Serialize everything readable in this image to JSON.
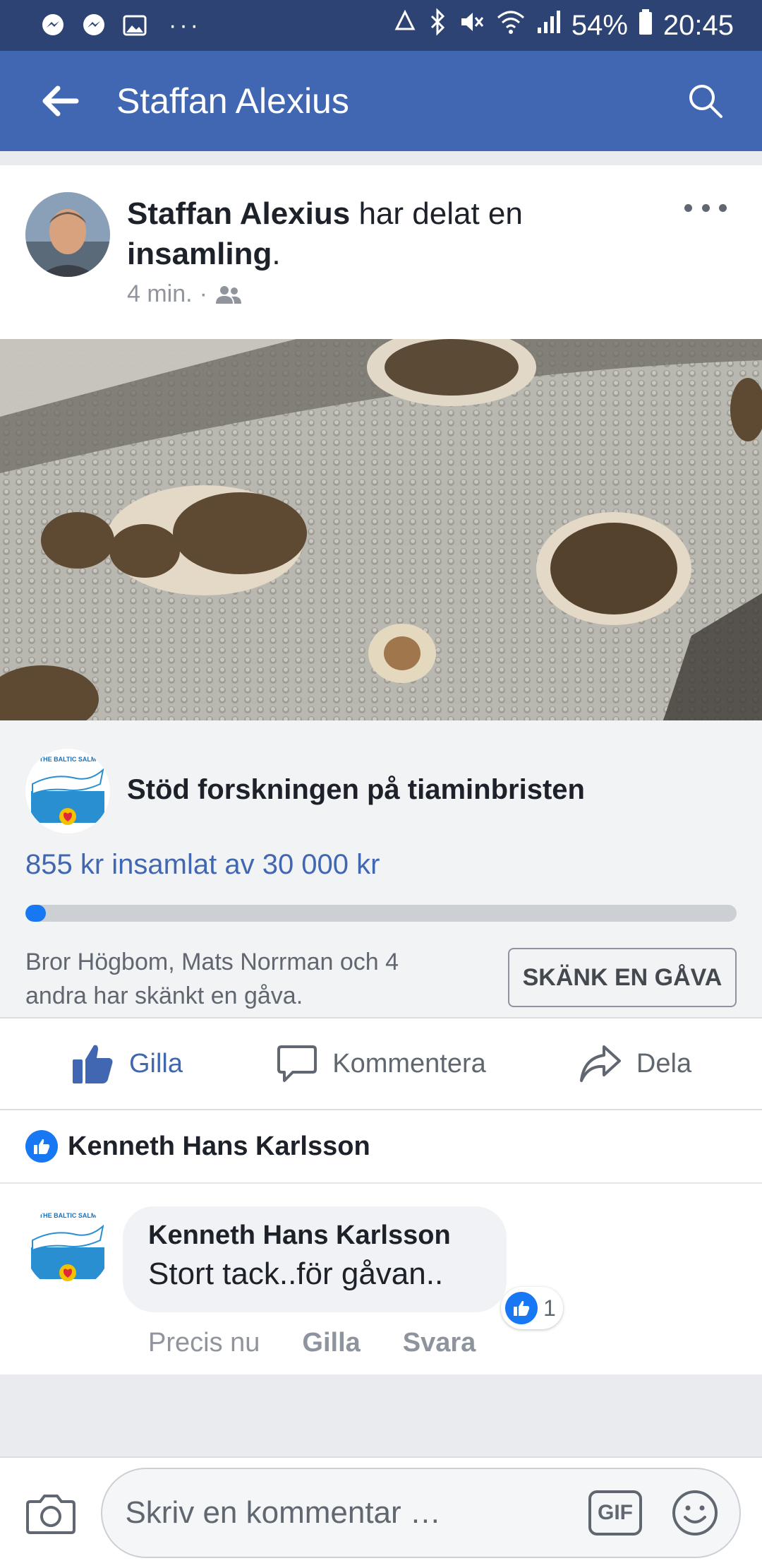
{
  "status_bar": {
    "battery": "54%",
    "time": "20:45",
    "more": "···"
  },
  "app_bar": {
    "title": "Staffan Alexius"
  },
  "post": {
    "author": "Staffan Alexius",
    "action_text": " har delat en ",
    "object": "insamling",
    "punct": ".",
    "time": "4 min.",
    "meta_sep": "·",
    "audience_icon": "friends-icon"
  },
  "fundraiser": {
    "logo_text": "THE BALTIC SALM",
    "title": "Stöd forskningen på tiaminbristen",
    "amount_text": "855 kr insamlat av 30 000 kr",
    "raised": 855,
    "goal": 30000,
    "donors_text": "Bror Högbom, Mats Norrman och 4 andra har skänkt en gåva.",
    "donate_label": "SKÄNK EN GÅVA"
  },
  "actions": {
    "like": "Gilla",
    "comment": "Kommentera",
    "share": "Dela"
  },
  "likers": {
    "name": "Kenneth Hans Karlsson"
  },
  "comment": {
    "author": "Kenneth Hans Karlsson",
    "text": "Stort tack..för gåvan..",
    "reaction_count": "1",
    "time": "Precis nu",
    "like": "Gilla",
    "reply": "Svara"
  },
  "composer": {
    "placeholder": "Skriv en kommentar …",
    "gif": "GIF"
  },
  "colors": {
    "brand": "#4267b2",
    "status_bar": "#2d4373",
    "like_blue": "#1877f2"
  }
}
